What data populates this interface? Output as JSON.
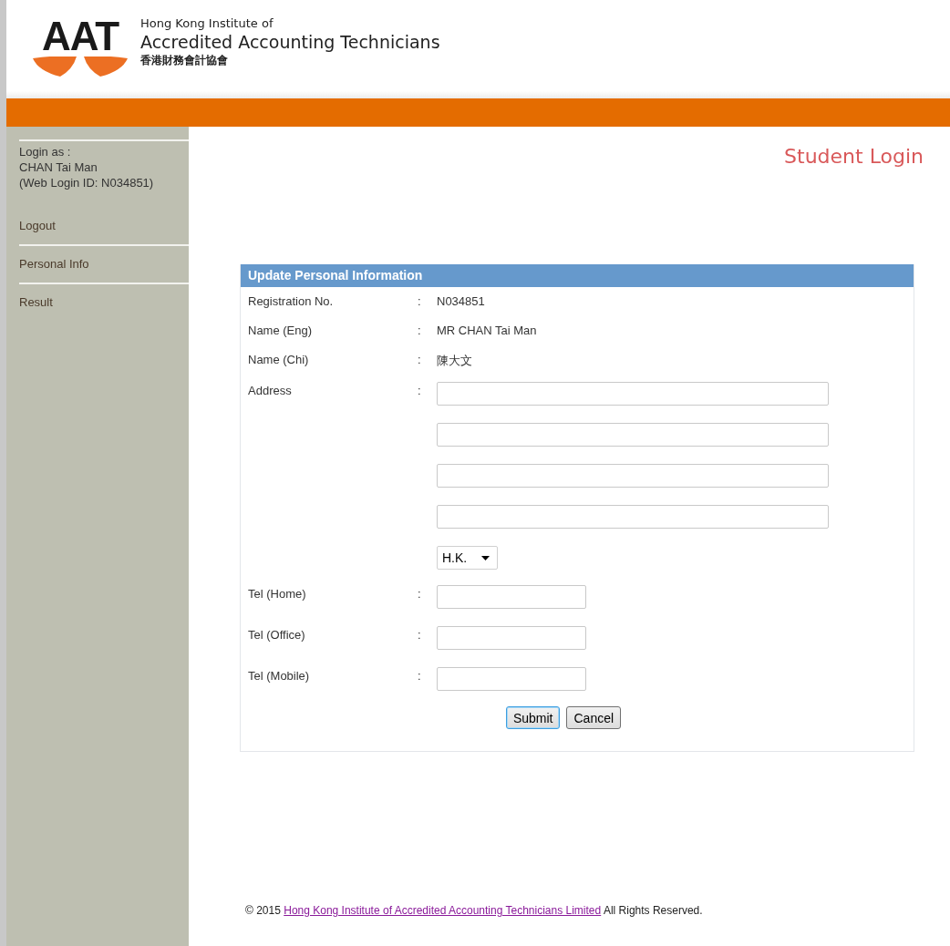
{
  "header": {
    "logo_mark": "AAT",
    "name_line_1": "Hong Kong Institute of",
    "name_line_2": "Accredited Accounting Technicians",
    "name_chinese": "香港財務會計協會"
  },
  "sidebar": {
    "login_info": [
      "Login as :",
      "CHAN Tai Man",
      "(Web Login ID: N034851)"
    ],
    "items": [
      {
        "label": "Logout"
      },
      {
        "label": "Personal Info"
      },
      {
        "label": "Result"
      }
    ]
  },
  "page_title": "Student Login",
  "panel": {
    "title": "Update Personal Information",
    "rows": [
      {
        "kind": "text",
        "label": "Registration No.",
        "separator": ":",
        "value": "N034851"
      },
      {
        "kind": "text",
        "label": "Name (Eng)",
        "separator": ":",
        "value": "MR CHAN Tai Man"
      },
      {
        "kind": "text",
        "label": "Name (Chi)",
        "separator": ":",
        "value": "陳大文"
      },
      {
        "kind": "input",
        "label": "Address",
        "separator": ":"
      },
      {
        "kind": "input"
      },
      {
        "kind": "input"
      },
      {
        "kind": "input"
      },
      {
        "kind": "select",
        "value": "H.K."
      },
      {
        "kind": "short_input",
        "label": "Tel (Home)",
        "separator": ":"
      },
      {
        "kind": "short_input",
        "label": "Tel (Office)",
        "separator": ":"
      },
      {
        "kind": "short_input",
        "label": "Tel (Mobile)",
        "separator": ":"
      }
    ],
    "buttons": [
      {
        "label": "Submit",
        "focused": true
      },
      {
        "label": "Cancel",
        "focused": false
      }
    ]
  },
  "footer": {
    "prefix": "© 2015",
    "link": "Hong Kong Institute of Accredited Accounting Technicians Limited",
    "suffix": "All Rights Reserved."
  }
}
